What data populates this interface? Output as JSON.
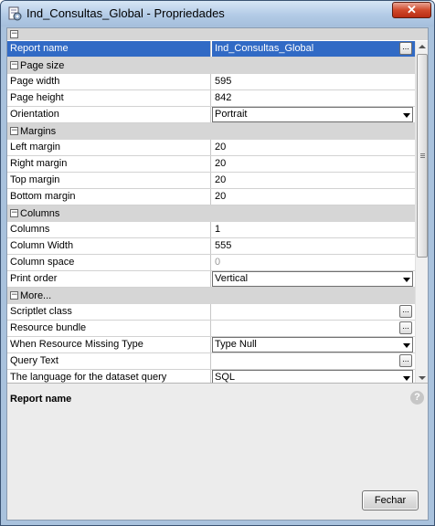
{
  "window": {
    "title": "Ind_Consultas_Global - Propriedades",
    "close_glyph": "✕",
    "app_icon": "report-properties-icon"
  },
  "grid": {
    "collapse_glyph": "−",
    "dots_glyph": "...",
    "rows": [
      {
        "type": "property",
        "name": "Report name",
        "value": "Ind_Consultas_Global",
        "editor": "dots",
        "selected": true
      },
      {
        "type": "section",
        "name": "Page size"
      },
      {
        "type": "property",
        "name": "Page width",
        "value": "595"
      },
      {
        "type": "property",
        "name": "Page height",
        "value": "842"
      },
      {
        "type": "property",
        "name": "Orientation",
        "value": "Portrait",
        "editor": "combo"
      },
      {
        "type": "section",
        "name": "Margins"
      },
      {
        "type": "property",
        "name": "Left margin",
        "value": "20"
      },
      {
        "type": "property",
        "name": "Right margin",
        "value": "20"
      },
      {
        "type": "property",
        "name": "Top margin",
        "value": "20"
      },
      {
        "type": "property",
        "name": "Bottom margin",
        "value": "20"
      },
      {
        "type": "section",
        "name": "Columns"
      },
      {
        "type": "property",
        "name": "Columns",
        "value": "1"
      },
      {
        "type": "property",
        "name": "Column Width",
        "value": "555"
      },
      {
        "type": "property",
        "name": "Column space",
        "value": "0",
        "disabled": true
      },
      {
        "type": "property",
        "name": "Print order",
        "value": "Vertical",
        "editor": "combo"
      },
      {
        "type": "section",
        "name": "More..."
      },
      {
        "type": "property",
        "name": "Scriptlet class",
        "value": "",
        "editor": "dots"
      },
      {
        "type": "property",
        "name": "Resource bundle",
        "value": "",
        "editor": "dots"
      },
      {
        "type": "property",
        "name": "When Resource Missing Type",
        "value": "Type Null",
        "editor": "combo"
      },
      {
        "type": "property",
        "name": "Query Text",
        "value": "",
        "editor": "dots"
      },
      {
        "type": "property",
        "name": "The language for the dataset query",
        "value": "SQL",
        "editor": "combo"
      }
    ]
  },
  "description": {
    "title": "Report name",
    "help_glyph": "?"
  },
  "footer": {
    "close_label": "Fechar"
  },
  "colors": {
    "selection": "#316ac5",
    "section_bg": "#d6d6d6",
    "title_close": "#d04a2c"
  }
}
